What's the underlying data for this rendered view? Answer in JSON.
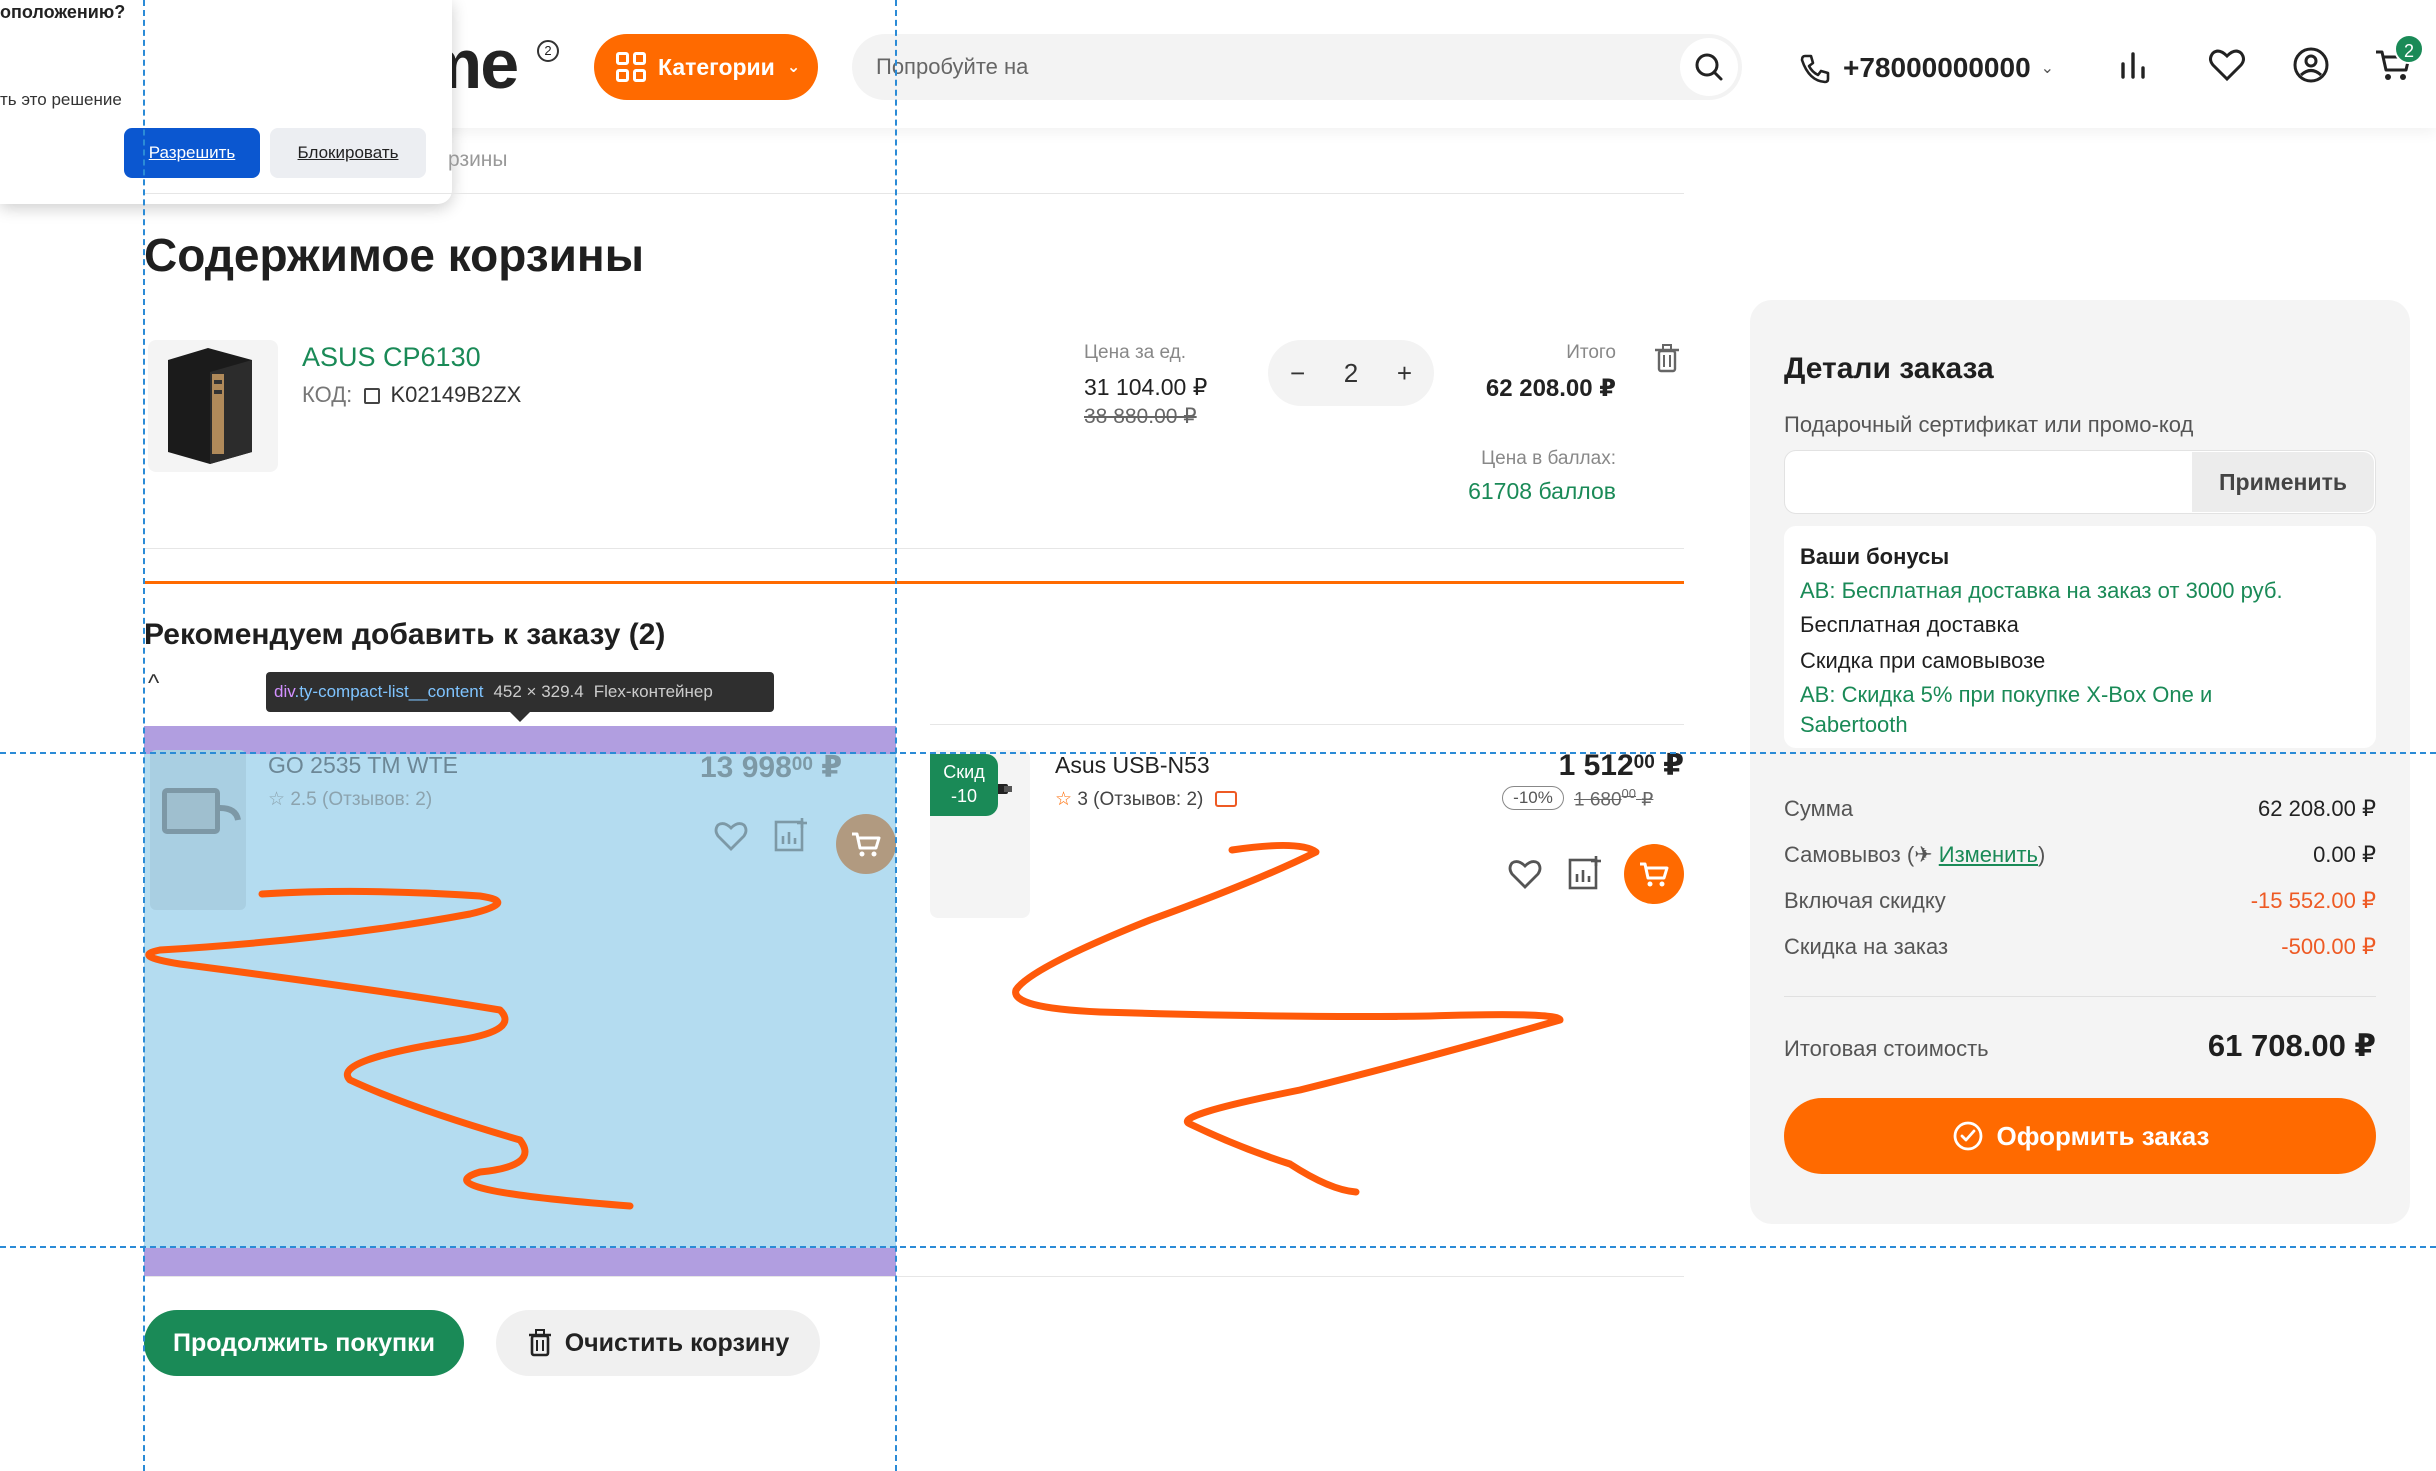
{
  "header": {
    "logo_text": "me",
    "logo_badge": "2",
    "categories_label": "Категории",
    "search_placeholder": "Попробуйте на",
    "phone": "+78000000000",
    "cart_count": "2"
  },
  "permission_popup": {
    "title": "оположению?",
    "subtitle": "ть это решение",
    "allow_label": "Разрешить",
    "block_label": "Блокировать"
  },
  "breadcrumb": "рзины",
  "page_title": "Содержимое корзины",
  "cart_item": {
    "name": "ASUS CP6130",
    "code_label": "КОД:",
    "code": "K02149B2ZX",
    "unit_price_label": "Цена за ед.",
    "unit_price": "31 104.00 ₽",
    "unit_old_price": "38 880.00 ₽",
    "quantity": "2",
    "qty_minus": "−",
    "qty_plus": "+",
    "total_label": "Итого",
    "total": "62 208.00 ₽",
    "points_label": "Цена в баллах:",
    "points": "61708 баллов"
  },
  "recommend": {
    "title": "Рекомендуем добавить к заказу (2)",
    "toggle": "^",
    "products": [
      {
        "name": "GO 2535 TM WTE",
        "rating": "2.5 (Отзывов: 2)",
        "price_main": "13 998",
        "price_cents": "00",
        "currency": "₽"
      },
      {
        "badge_line1": "Скид",
        "badge_line2": "-10",
        "name": "Asus USB-N53",
        "rating": "3 (Отзывов: 2)",
        "price_main": "1 512",
        "price_cents": "00",
        "currency": "₽",
        "discount": "-10%",
        "old_price": "1 680",
        "old_cents": "00",
        "old_currency": "₽"
      }
    ]
  },
  "devtools_tooltip": {
    "tag": "div",
    "class": ".ty-compact-list__content",
    "size": "452 × 329.4",
    "type": "Flex-контейнер"
  },
  "actions": {
    "continue_label": "Продолжить покупки",
    "clear_label": "Очистить корзину"
  },
  "order": {
    "title": "Детали заказа",
    "promo_label": "Подарочный сертификат или промо-код",
    "apply_label": "Применить",
    "bonuses_title": "Ваши бонусы",
    "bonuses": [
      {
        "text": "АВ: Бесплатная доставка на заказ от 3000 руб.",
        "link": true
      },
      {
        "text": "Бесплатная доставка",
        "link": false
      },
      {
        "text": "Скидка при самовывозе",
        "link": false
      },
      {
        "text": "АВ: Скидка 5% при покупке X-Box One и Sabertooth",
        "link": true
      }
    ],
    "sum_label": "Сумма",
    "sum": "62 208.00 ₽",
    "pickup_label": "Самовывоз (",
    "pickup_change": "Изменить",
    "pickup_close": ")",
    "pickup": "0.00 ₽",
    "discount_label": "Включая скидку",
    "discount": "-15 552.00 ₽",
    "order_discount_label": "Скидка на заказ",
    "order_discount": "-500.00 ₽",
    "grand_label": "Итоговая стоимость",
    "grand_total": "61 708.00 ₽",
    "checkout_label": "Оформить заказ"
  },
  "colors": {
    "accent": "#ff6a00",
    "green": "#1a8a57",
    "red": "#ee5a24"
  }
}
